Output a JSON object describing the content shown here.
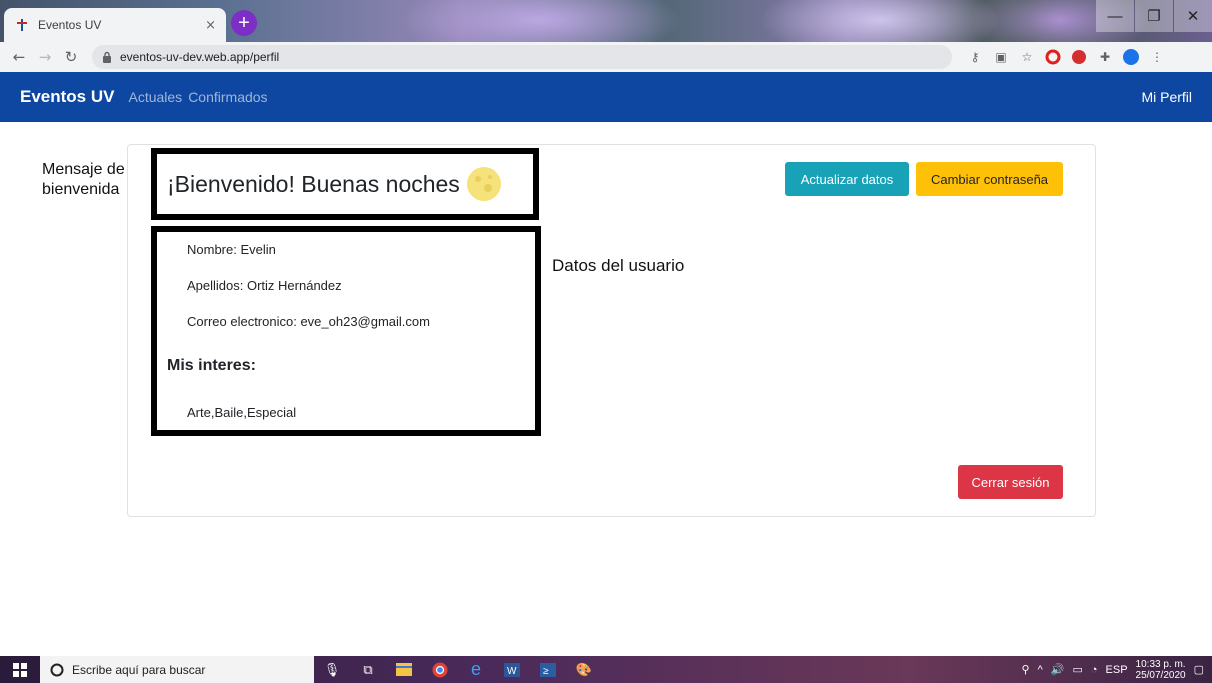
{
  "browser": {
    "tab_title": "Eventos UV",
    "tab_close": "×",
    "new_tab": "+",
    "url": "eventos-uv-dev.web.app/perfil"
  },
  "navbar": {
    "brand": "Eventos UV",
    "links": [
      "Actuales",
      "Confirmados"
    ],
    "right": "Mi Perfil"
  },
  "page": {
    "side_note": "Mensaje de bienvenida",
    "welcome": "¡Bienvenido! Buenas noches",
    "user_data_label": "Datos del usuario",
    "fields": {
      "nombre": "Nombre: Evelin",
      "apellidos": "Apellidos: Ortiz Hernández",
      "correo": "Correo electronico: eve_oh23@gmail.com"
    },
    "interests_heading": "Mis interes:",
    "interests": "Arte,Baile,Especial",
    "buttons": {
      "update": "Actualizar datos",
      "change_password": "Cambiar contraseña",
      "logout": "Cerrar sesión"
    }
  },
  "taskbar": {
    "search_placeholder": "Escribe aquí para buscar",
    "language": "ESP",
    "time": "10:33 p. m.",
    "date": "25/07/2020"
  },
  "colors": {
    "navbar": "#0d47a1",
    "info": "#17a2b8",
    "warning": "#ffc107",
    "danger": "#dc3545"
  }
}
